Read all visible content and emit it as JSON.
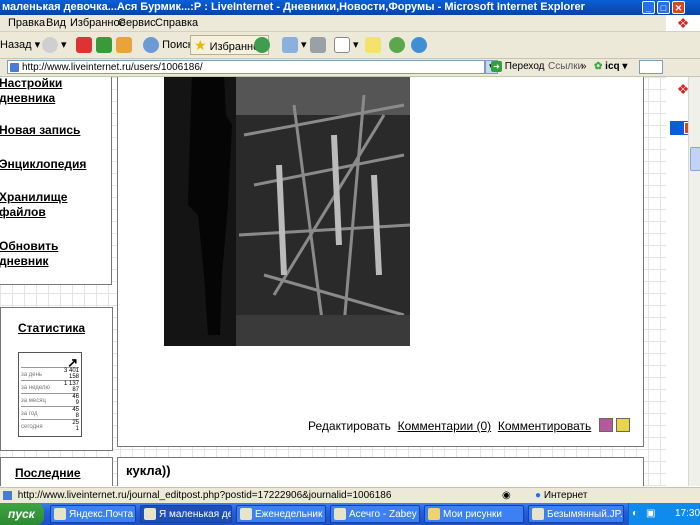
{
  "window": {
    "title": "маленькая девочка...Ася Бурмик...:Р : LiveInternet - Дневники,Новости,Форумы - Microsoft Internet Explorer"
  },
  "menu": [
    "Правка",
    "Вид",
    "Избранное",
    "Сервис",
    "Справка"
  ],
  "toolbar": {
    "back": "Назад",
    "search": "Поиск",
    "favorites": "Избранное"
  },
  "address": {
    "url": "http://www.liveinternet.ru/users/1006186/",
    "go": "Переход",
    "links": "Ссылки",
    "icq": "icq"
  },
  "sidebar": {
    "items": [
      {
        "line1": "Настройки",
        "line2": "дневника"
      },
      {
        "line1": "Новая запись",
        "line2": ""
      },
      {
        "line1": "Энциклопедия",
        "line2": ""
      },
      {
        "line1": "Хранилище",
        "line2": "файлов"
      },
      {
        "line1": "Обновить",
        "line2": "дневник"
      }
    ],
    "stats_title": "Статистика",
    "stats": {
      "rows": [
        {
          "label": "за день",
          "value": "3 401\n158"
        },
        {
          "label": "за неделю",
          "value": "1 137\n87"
        },
        {
          "label": "за месяц",
          "value": "46\n9"
        },
        {
          "label": "за год",
          "value": "45\n8"
        },
        {
          "label": "сегодня",
          "value": "25\n1"
        }
      ]
    },
    "bottom_title": "Последние"
  },
  "post": {
    "edit": "Редактировать",
    "comments": "Комментарии (0)",
    "comment": "Комментировать",
    "next_title": "кукла))"
  },
  "status": {
    "url": "http://www.liveinternet.ru/journal_editpost.php?postid=17222906&journalid=1006186",
    "zone": "Интернет"
  },
  "taskbar": {
    "start": "пуск",
    "tasks": [
      "Яндекс.Почта - ...",
      "Я маленькая дев...",
      "Еженедельник \"...",
      "Асечго - Zabey ...",
      "Мои рисунки",
      "Безымянный.JP..."
    ],
    "time": "17:30"
  }
}
